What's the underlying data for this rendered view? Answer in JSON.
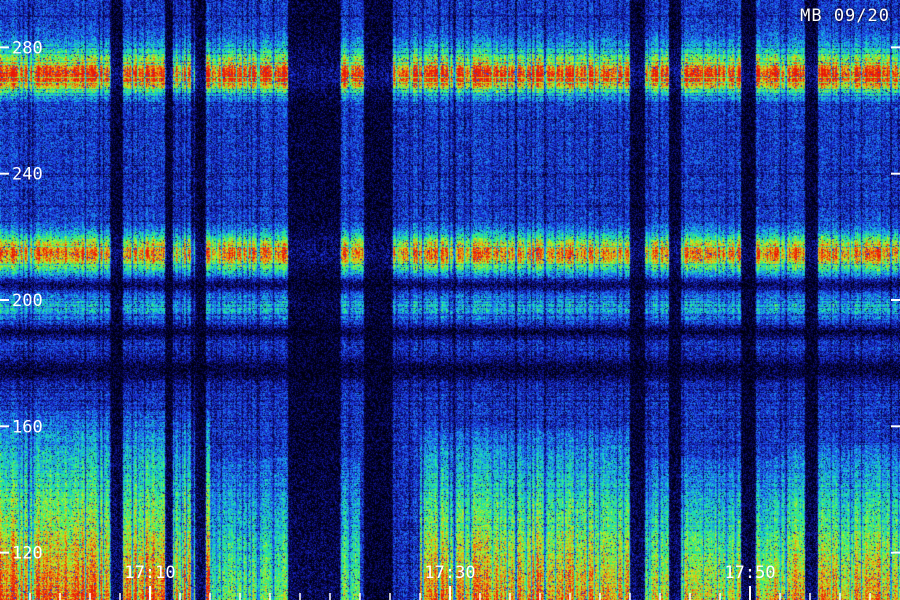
{
  "chart_data": {
    "type": "heatmap",
    "title": "MB 09/20",
    "y_ticks": [
      "120",
      "160",
      "200",
      "240",
      "280"
    ],
    "y_tick_values": [
      120,
      160,
      200,
      240,
      280
    ],
    "ylim": [
      105,
      295
    ],
    "x_ticks": [
      "17:10",
      "17:30",
      "17:50"
    ],
    "x_tick_values": [
      10,
      30,
      50
    ],
    "xlim": [
      0,
      60
    ],
    "colormap": [
      "#000010",
      "#0b0b6e",
      "#1a2fd8",
      "#1e78f0",
      "#16d6d0",
      "#38f06a",
      "#c4f020",
      "#f08a10",
      "#e81808"
    ],
    "bright_bands": [
      {
        "center": 215,
        "width": 6,
        "intensity": 0.62
      },
      {
        "center": 270,
        "width": 5,
        "intensity": 0.48
      },
      {
        "center": 275,
        "width": 7,
        "intensity": 0.36
      },
      {
        "center": 198,
        "width": 4,
        "intensity": 0.22
      }
    ],
    "dark_bands": [
      {
        "center": 178,
        "width": 4
      },
      {
        "center": 205,
        "width": 2
      },
      {
        "center": 190,
        "width": 2
      }
    ],
    "low_freq_energy": [
      {
        "start": 0,
        "end": 14,
        "intensity": 0.62,
        "top": 165
      },
      {
        "start": 14,
        "end": 24,
        "intensity": 0.35,
        "top": 150
      },
      {
        "start": 28,
        "end": 42,
        "intensity": 0.58,
        "top": 160
      },
      {
        "start": 42,
        "end": 52,
        "intensity": 0.48,
        "top": 150
      },
      {
        "start": 52,
        "end": 60,
        "intensity": 0.55,
        "top": 155
      }
    ],
    "gaps": [
      {
        "start": 19.2,
        "end": 22.6
      },
      {
        "start": 24.3,
        "end": 26.2
      },
      {
        "start": 7.4,
        "end": 8.2
      },
      {
        "start": 11.0,
        "end": 11.5
      },
      {
        "start": 13.0,
        "end": 13.7
      },
      {
        "start": 42.0,
        "end": 43.0
      },
      {
        "start": 44.6,
        "end": 45.4
      },
      {
        "start": 49.4,
        "end": 50.4
      },
      {
        "start": 53.7,
        "end": 54.5
      }
    ]
  }
}
